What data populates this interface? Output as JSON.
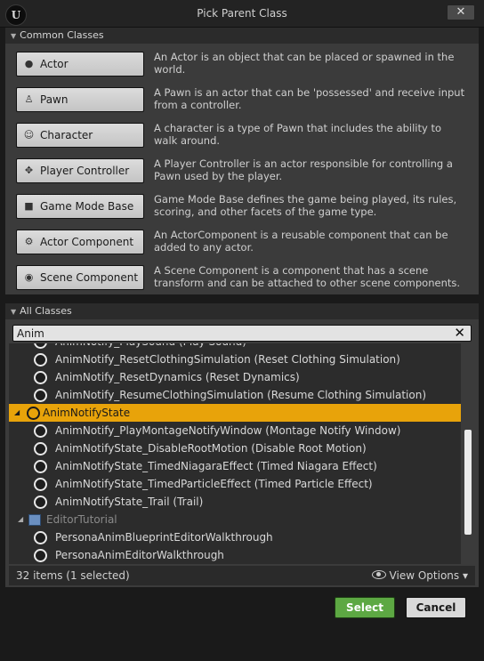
{
  "window": {
    "title": "Pick Parent Class",
    "close_icon": "close-icon",
    "logo": "U"
  },
  "common": {
    "header": "Common Classes",
    "items": [
      {
        "label": "Actor",
        "icon": "actor-sphere-icon",
        "glyph": "●",
        "description": "An Actor is an object that can be placed or spawned in the world."
      },
      {
        "label": "Pawn",
        "icon": "pawn-icon",
        "glyph": "♙",
        "description": "A Pawn is an actor that can be 'possessed' and receive input from a controller."
      },
      {
        "label": "Character",
        "icon": "character-icon",
        "glyph": "☺",
        "description": "A character is a type of Pawn that includes the ability to walk around."
      },
      {
        "label": "Player Controller",
        "icon": "player-controller-icon",
        "glyph": "✥",
        "description": "A Player Controller is an actor responsible for controlling a Pawn used by the player."
      },
      {
        "label": "Game Mode Base",
        "icon": "game-mode-icon",
        "glyph": "■",
        "description": "Game Mode Base defines the game being played, its rules, scoring, and other facets of the game type."
      },
      {
        "label": "Actor Component",
        "icon": "actor-component-icon",
        "glyph": "⚙",
        "description": "An ActorComponent is a reusable component that can be added to any actor."
      },
      {
        "label": "Scene Component",
        "icon": "scene-component-icon",
        "glyph": "◉",
        "description": "A Scene Component is a component that has a scene transform and can be attached to other scene components."
      }
    ]
  },
  "all_classes": {
    "header": "All Classes",
    "search_value": "Anim",
    "tree": [
      {
        "label": "AnimNotify_PlaySound (Play Sound)",
        "kind": "radio"
      },
      {
        "label": "AnimNotify_ResetClothingSimulation (Reset Clothing Simulation)",
        "kind": "radio"
      },
      {
        "label": "AnimNotify_ResetDynamics (Reset Dynamics)",
        "kind": "radio"
      },
      {
        "label": "AnimNotify_ResumeClothingSimulation (Resume Clothing Simulation)",
        "kind": "radio"
      },
      {
        "label": "AnimNotifyState",
        "kind": "radio-parent",
        "selected": true
      },
      {
        "label": "AnimNotify_PlayMontageNotifyWindow (Montage Notify Window)",
        "kind": "radio"
      },
      {
        "label": "AnimNotifyState_DisableRootMotion (Disable Root Motion)",
        "kind": "radio"
      },
      {
        "label": "AnimNotifyState_TimedNiagaraEffect (Timed Niagara Effect)",
        "kind": "radio"
      },
      {
        "label": "AnimNotifyState_TimedParticleEffect (Timed Particle Effect)",
        "kind": "radio"
      },
      {
        "label": "AnimNotifyState_Trail (Trail)",
        "kind": "radio"
      },
      {
        "label": "EditorTutorial",
        "kind": "folder"
      },
      {
        "label": "PersonaAnimBlueprintEditorWalkthrough",
        "kind": "radio"
      },
      {
        "label": "PersonaAnimEditorWalkthrough",
        "kind": "radio"
      }
    ],
    "status": "32 items (1 selected)",
    "view_options": "View Options"
  },
  "buttons": {
    "select": "Select",
    "cancel": "Cancel"
  },
  "colors": {
    "selected_row": "#e8a30a",
    "select_button": "#5da843"
  }
}
